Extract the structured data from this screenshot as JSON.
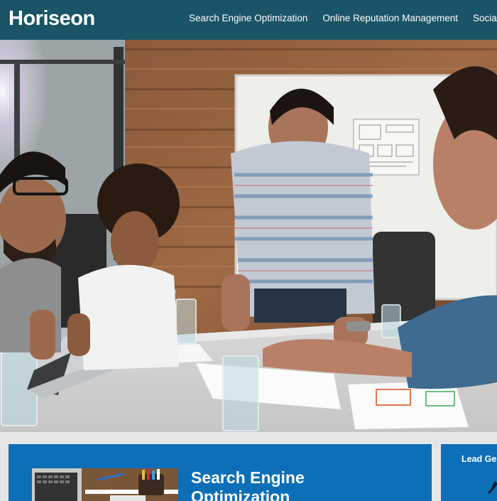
{
  "header": {
    "logo": "Horiseon",
    "nav": [
      "Search Engine Optimization",
      "Online Reputation Management",
      "Social Media Marketing"
    ]
  },
  "hero": {
    "image": "team-meeting-photo"
  },
  "main": {
    "seo_heading": "Search Engine Optimization"
  },
  "sidebar": {
    "heading": "Lead Generation"
  },
  "colors": {
    "header_bg": "#1b5466",
    "panel_bg": "#0d6fb8",
    "page_bg": "#e6e6e6",
    "text": "#ffffff"
  }
}
